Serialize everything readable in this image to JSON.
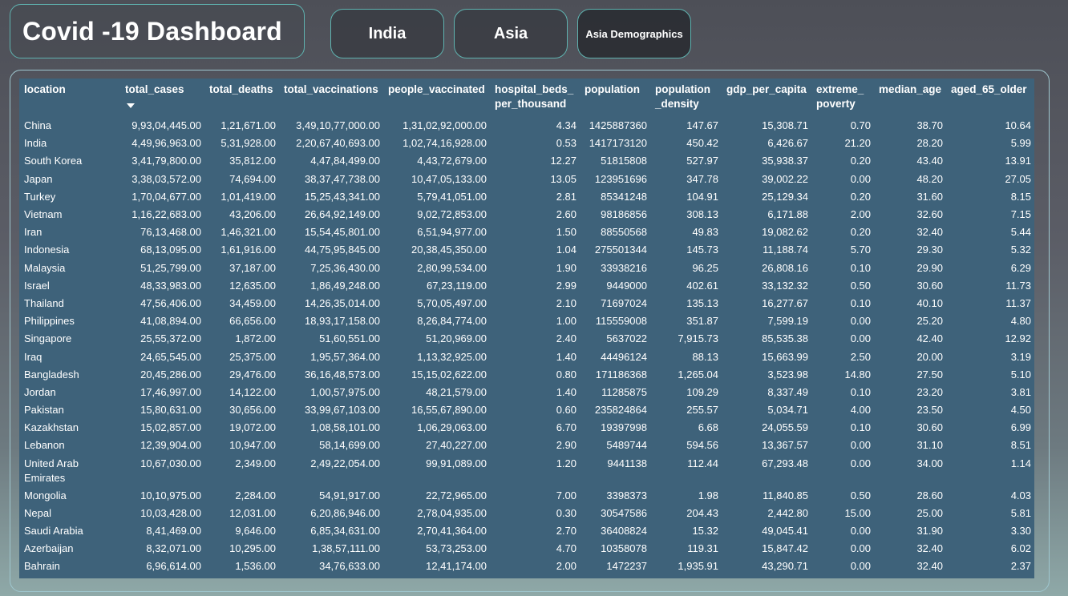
{
  "header": {
    "title": "Covid -19 Dashboard",
    "buttons": [
      {
        "label": "India"
      },
      {
        "label": "Asia"
      },
      {
        "label": "Asia Demographics"
      }
    ]
  },
  "table": {
    "sorted_column": "total_cases",
    "sort_direction": "descending",
    "columns": [
      "location",
      "total_cases",
      "total_deaths",
      "total_vaccinations",
      "people_vaccinated",
      "hospital_beds_\nper_thousand",
      "population",
      "population\n_density",
      "gdp_per_capita",
      "extreme_\npoverty",
      "median_age",
      "aged_65_older"
    ],
    "rows": [
      [
        "China",
        "9,93,04,445.00",
        "1,21,671.00",
        "3,49,10,77,000.00",
        "1,31,02,92,000.00",
        "4.34",
        "1425887360",
        "147.67",
        "15,308.71",
        "0.70",
        "38.70",
        "10.64"
      ],
      [
        "India",
        "4,49,96,963.00",
        "5,31,928.00",
        "2,20,67,40,693.00",
        "1,02,74,16,928.00",
        "0.53",
        "1417173120",
        "450.42",
        "6,426.67",
        "21.20",
        "28.20",
        "5.99"
      ],
      [
        "South Korea",
        "3,41,79,800.00",
        "35,812.00",
        "4,47,84,499.00",
        "4,43,72,679.00",
        "12.27",
        "51815808",
        "527.97",
        "35,938.37",
        "0.20",
        "43.40",
        "13.91"
      ],
      [
        "Japan",
        "3,38,03,572.00",
        "74,694.00",
        "38,37,47,738.00",
        "10,47,05,133.00",
        "13.05",
        "123951696",
        "347.78",
        "39,002.22",
        "0.00",
        "48.20",
        "27.05"
      ],
      [
        "Turkey",
        "1,70,04,677.00",
        "1,01,419.00",
        "15,25,43,341.00",
        "5,79,41,051.00",
        "2.81",
        "85341248",
        "104.91",
        "25,129.34",
        "0.20",
        "31.60",
        "8.15"
      ],
      [
        "Vietnam",
        "1,16,22,683.00",
        "43,206.00",
        "26,64,92,149.00",
        "9,02,72,853.00",
        "2.60",
        "98186856",
        "308.13",
        "6,171.88",
        "2.00",
        "32.60",
        "7.15"
      ],
      [
        "Iran",
        "76,13,468.00",
        "1,46,321.00",
        "15,54,45,801.00",
        "6,51,94,977.00",
        "1.50",
        "88550568",
        "49.83",
        "19,082.62",
        "0.20",
        "32.40",
        "5.44"
      ],
      [
        "Indonesia",
        "68,13,095.00",
        "1,61,916.00",
        "44,75,95,845.00",
        "20,38,45,350.00",
        "1.04",
        "275501344",
        "145.73",
        "11,188.74",
        "5.70",
        "29.30",
        "5.32"
      ],
      [
        "Malaysia",
        "51,25,799.00",
        "37,187.00",
        "7,25,36,430.00",
        "2,80,99,534.00",
        "1.90",
        "33938216",
        "96.25",
        "26,808.16",
        "0.10",
        "29.90",
        "6.29"
      ],
      [
        "Israel",
        "48,33,983.00",
        "12,635.00",
        "1,86,49,248.00",
        "67,23,119.00",
        "2.99",
        "9449000",
        "402.61",
        "33,132.32",
        "0.50",
        "30.60",
        "11.73"
      ],
      [
        "Thailand",
        "47,56,406.00",
        "34,459.00",
        "14,26,35,014.00",
        "5,70,05,497.00",
        "2.10",
        "71697024",
        "135.13",
        "16,277.67",
        "0.10",
        "40.10",
        "11.37"
      ],
      [
        "Philippines",
        "41,08,894.00",
        "66,656.00",
        "18,93,17,158.00",
        "8,26,84,774.00",
        "1.00",
        "115559008",
        "351.87",
        "7,599.19",
        "0.00",
        "25.20",
        "4.80"
      ],
      [
        "Singapore",
        "25,55,372.00",
        "1,872.00",
        "51,60,551.00",
        "51,20,969.00",
        "2.40",
        "5637022",
        "7,915.73",
        "85,535.38",
        "0.00",
        "42.40",
        "12.92"
      ],
      [
        "Iraq",
        "24,65,545.00",
        "25,375.00",
        "1,95,57,364.00",
        "1,13,32,925.00",
        "1.40",
        "44496124",
        "88.13",
        "15,663.99",
        "2.50",
        "20.00",
        "3.19"
      ],
      [
        "Bangladesh",
        "20,45,286.00",
        "29,476.00",
        "36,16,48,573.00",
        "15,15,02,622.00",
        "0.80",
        "171186368",
        "1,265.04",
        "3,523.98",
        "14.80",
        "27.50",
        "5.10"
      ],
      [
        "Jordan",
        "17,46,997.00",
        "14,122.00",
        "1,00,57,975.00",
        "48,21,579.00",
        "1.40",
        "11285875",
        "109.29",
        "8,337.49",
        "0.10",
        "23.20",
        "3.81"
      ],
      [
        "Pakistan",
        "15,80,631.00",
        "30,656.00",
        "33,99,67,103.00",
        "16,55,67,890.00",
        "0.60",
        "235824864",
        "255.57",
        "5,034.71",
        "4.00",
        "23.50",
        "4.50"
      ],
      [
        "Kazakhstan",
        "15,02,857.00",
        "19,072.00",
        "1,08,58,101.00",
        "1,06,29,063.00",
        "6.70",
        "19397998",
        "6.68",
        "24,055.59",
        "0.10",
        "30.60",
        "6.99"
      ],
      [
        "Lebanon",
        "12,39,904.00",
        "10,947.00",
        "58,14,699.00",
        "27,40,227.00",
        "2.90",
        "5489744",
        "594.56",
        "13,367.57",
        "0.00",
        "31.10",
        "8.51"
      ],
      [
        "United Arab Emirates",
        "10,67,030.00",
        "2,349.00",
        "2,49,22,054.00",
        "99,91,089.00",
        "1.20",
        "9441138",
        "112.44",
        "67,293.48",
        "0.00",
        "34.00",
        "1.14"
      ],
      [
        "Mongolia",
        "10,10,975.00",
        "2,284.00",
        "54,91,917.00",
        "22,72,965.00",
        "7.00",
        "3398373",
        "1.98",
        "11,840.85",
        "0.50",
        "28.60",
        "4.03"
      ],
      [
        "Nepal",
        "10,03,428.00",
        "12,031.00",
        "6,20,86,946.00",
        "2,78,04,935.00",
        "0.30",
        "30547586",
        "204.43",
        "2,442.80",
        "15.00",
        "25.00",
        "5.81"
      ],
      [
        "Saudi Arabia",
        "8,41,469.00",
        "9,646.00",
        "6,85,34,631.00",
        "2,70,41,364.00",
        "2.70",
        "36408824",
        "15.32",
        "49,045.41",
        "0.00",
        "31.90",
        "3.30"
      ],
      [
        "Azerbaijan",
        "8,32,071.00",
        "10,295.00",
        "1,38,57,111.00",
        "53,73,253.00",
        "4.70",
        "10358078",
        "119.31",
        "15,847.42",
        "0.00",
        "32.40",
        "6.02"
      ],
      [
        "Bahrain",
        "6,96,614.00",
        "1,536.00",
        "34,76,633.00",
        "12,41,174.00",
        "2.00",
        "1472237",
        "1,935.91",
        "43,290.71",
        "0.00",
        "32.40",
        "2.37"
      ]
    ]
  }
}
